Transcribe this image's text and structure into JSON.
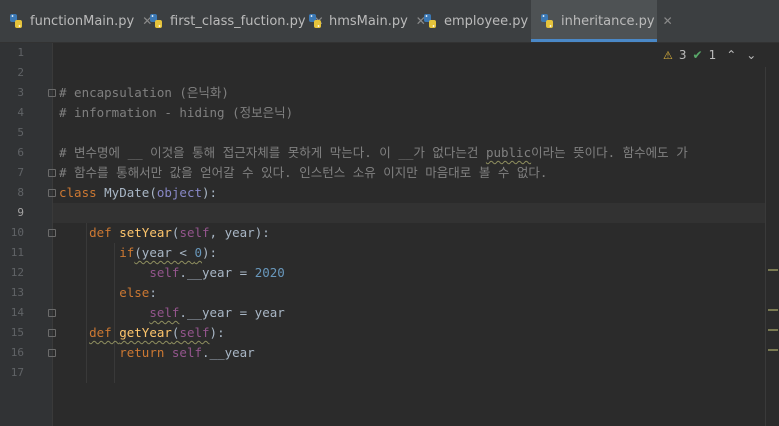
{
  "tabs": [
    {
      "label": "functionMain.py",
      "active": false
    },
    {
      "label": "first_class_fuction.py",
      "active": false
    },
    {
      "label": "hmsMain.py",
      "active": false
    },
    {
      "label": "employee.py",
      "active": false
    },
    {
      "label": "inheritance.py",
      "active": true
    }
  ],
  "close_glyph": "✕",
  "inspections": {
    "warnings": "3",
    "ok": "1"
  },
  "lines": [
    {
      "n": "1"
    },
    {
      "n": "2"
    },
    {
      "n": "3"
    },
    {
      "n": "4"
    },
    {
      "n": "5"
    },
    {
      "n": "6"
    },
    {
      "n": "7"
    },
    {
      "n": "8"
    },
    {
      "n": "9"
    },
    {
      "n": "10"
    },
    {
      "n": "11"
    },
    {
      "n": "12"
    },
    {
      "n": "13"
    },
    {
      "n": "14"
    },
    {
      "n": "15"
    },
    {
      "n": "16"
    },
    {
      "n": "17"
    }
  ],
  "code": {
    "l3": "# encapsulation (은닉화)",
    "l4": "# information - hiding (정보은닉)",
    "l6a": "# 변수명에 __ 이것을 통해 접근자체를 못하게 막는다. 이 __가 없다는건 ",
    "l6b": "public",
    "l6c": "이라는 뜻이다. 함수에도 가",
    "l7": "# 함수를 통해서만 값을 얻어갈 수 있다. 인스턴스 소유 이지만 마음대로 볼 수 없다.",
    "l8_kw": "class ",
    "l8_name": "MyDate",
    "l8_paren_open": "(",
    "l8_base": "object",
    "l8_end": "):",
    "l10_kw": "def ",
    "l10_fn": "setYear",
    "l10_a": "(",
    "l10_self": "self",
    "l10_b": ", year):",
    "l11_kw": "if",
    "l11_a": "(year < ",
    "l11_num": "0",
    "l11_b": "):",
    "l12_self": "self",
    "l12_a": ".__year = ",
    "l12_num": "2020",
    "l13_kw": "else",
    "l13_a": ":",
    "l14_self": "self",
    "l14_a": ".__year = year",
    "l15_kw": "def ",
    "l15_fn": "getYear",
    "l15_a": "(",
    "l15_self": "self",
    "l15_b": "):",
    "l16_kw": "return ",
    "l16_self": "self",
    "l16_a": ".__year"
  },
  "colors": {
    "background": "#2b2b2b",
    "keyword": "#cc7832",
    "comment": "#808080",
    "function": "#ffc66d",
    "self": "#94558d",
    "number": "#6897bb",
    "accent": "#4a88c7"
  }
}
